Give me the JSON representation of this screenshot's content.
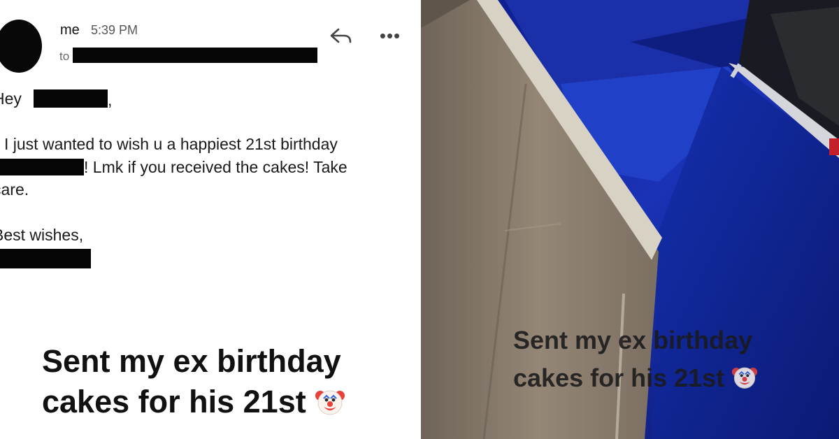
{
  "email": {
    "sender": "me",
    "time": "5:39 PM",
    "to_label": "to",
    "greeting": "Hey",
    "greeting_comma": ",",
    "line1": "I just wanted to wish u a happiest 21st birthday",
    "line2": "! Lmk if you received the cakes! Take",
    "line3": "care.",
    "closing": "Best wishes,",
    "reply_icon": "reply-icon",
    "more_icon": "more-options-icon",
    "more_glyph": "•••"
  },
  "captions": {
    "left_line1": "Sent my ex birthday",
    "left_line2": "cakes for his 21st",
    "right_line1": "Sent my ex birthday",
    "right_line2": "cakes for his 21st",
    "emoji_icon": "clown-face-icon"
  },
  "colors": {
    "redaction": "#050505",
    "box_blue": "#1c33b8",
    "cardboard": "#8a7d70"
  }
}
